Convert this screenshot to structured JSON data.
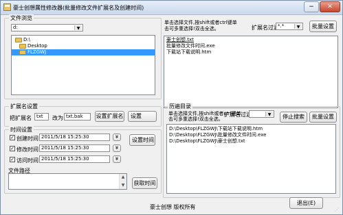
{
  "window": {
    "title": "豪士创想属性修改器(批量修改文件扩展名及创建时间)",
    "minimize_glyph": "−",
    "close_glyph": "✕"
  },
  "file_browser": {
    "group_title": "文件浏览",
    "drive_value": "d:",
    "dir_items": [
      {
        "label": "D:\\",
        "selected": false
      },
      {
        "label": "Desktop",
        "selected": false
      },
      {
        "label": "FLZGWJ",
        "selected": true
      }
    ]
  },
  "instructions": {
    "line1": "单击选择文件,按shift或者ctrl键单",
    "line2": "击可多重选择!双击全选。"
  },
  "ext_filter": {
    "label": "扩展名过滤",
    "value": "*.*"
  },
  "batch_settings_label": "批量设置",
  "file_list": [
    "豪士创想.txt",
    "批量修改文件时间.exe",
    "下载站下载说明.htm"
  ],
  "ext_settings": {
    "group_title": "扩展名设置",
    "label_change": "把扩展名",
    "from_value": "txt",
    "label_to": "改为",
    "to_value": "txt.bak",
    "set_ext_button": "设置扩展名"
  },
  "set_button_label": "设置",
  "time_settings": {
    "group_title": "时间设置",
    "rows": [
      {
        "label": "创建时间",
        "value": "2011/5/18 15:25:30",
        "checked": true,
        "btn": "¥"
      },
      {
        "label": "修改时间",
        "value": "2011/5/18 15:25:30",
        "checked": true,
        "btn": "¥"
      },
      {
        "label": "访问时间",
        "value": "2011/5/18 15:25:30",
        "checked": true,
        "btn": "¥"
      }
    ],
    "set_time_button": "设置时间",
    "path_label": "文件路径",
    "get_time_button": "获取时间"
  },
  "history": {
    "group_title": "历遍目录",
    "line1": "单击选择文件,按shift或者ctrl键单",
    "line2": "击可多重选择!双击全选。",
    "ext_filter_label": "扩展名过滤",
    "stop_button": "停止搜索",
    "batch_button": "批量设置",
    "items": [
      "D:\\Desktop\\FLZGWJ\\下载站下载说明.htm",
      "D:\\Desktop\\FLZGWJ\\批量修改文件时间.exe",
      "D:\\Desktop\\FLZGWJ\\豪士创想.txt"
    ]
  },
  "footer": {
    "copyright": "豪士创想 版权所有",
    "exit_button": "退出(E)"
  },
  "colors": {
    "selection": "#3399ff",
    "title_bg": "#dfe8f6"
  }
}
